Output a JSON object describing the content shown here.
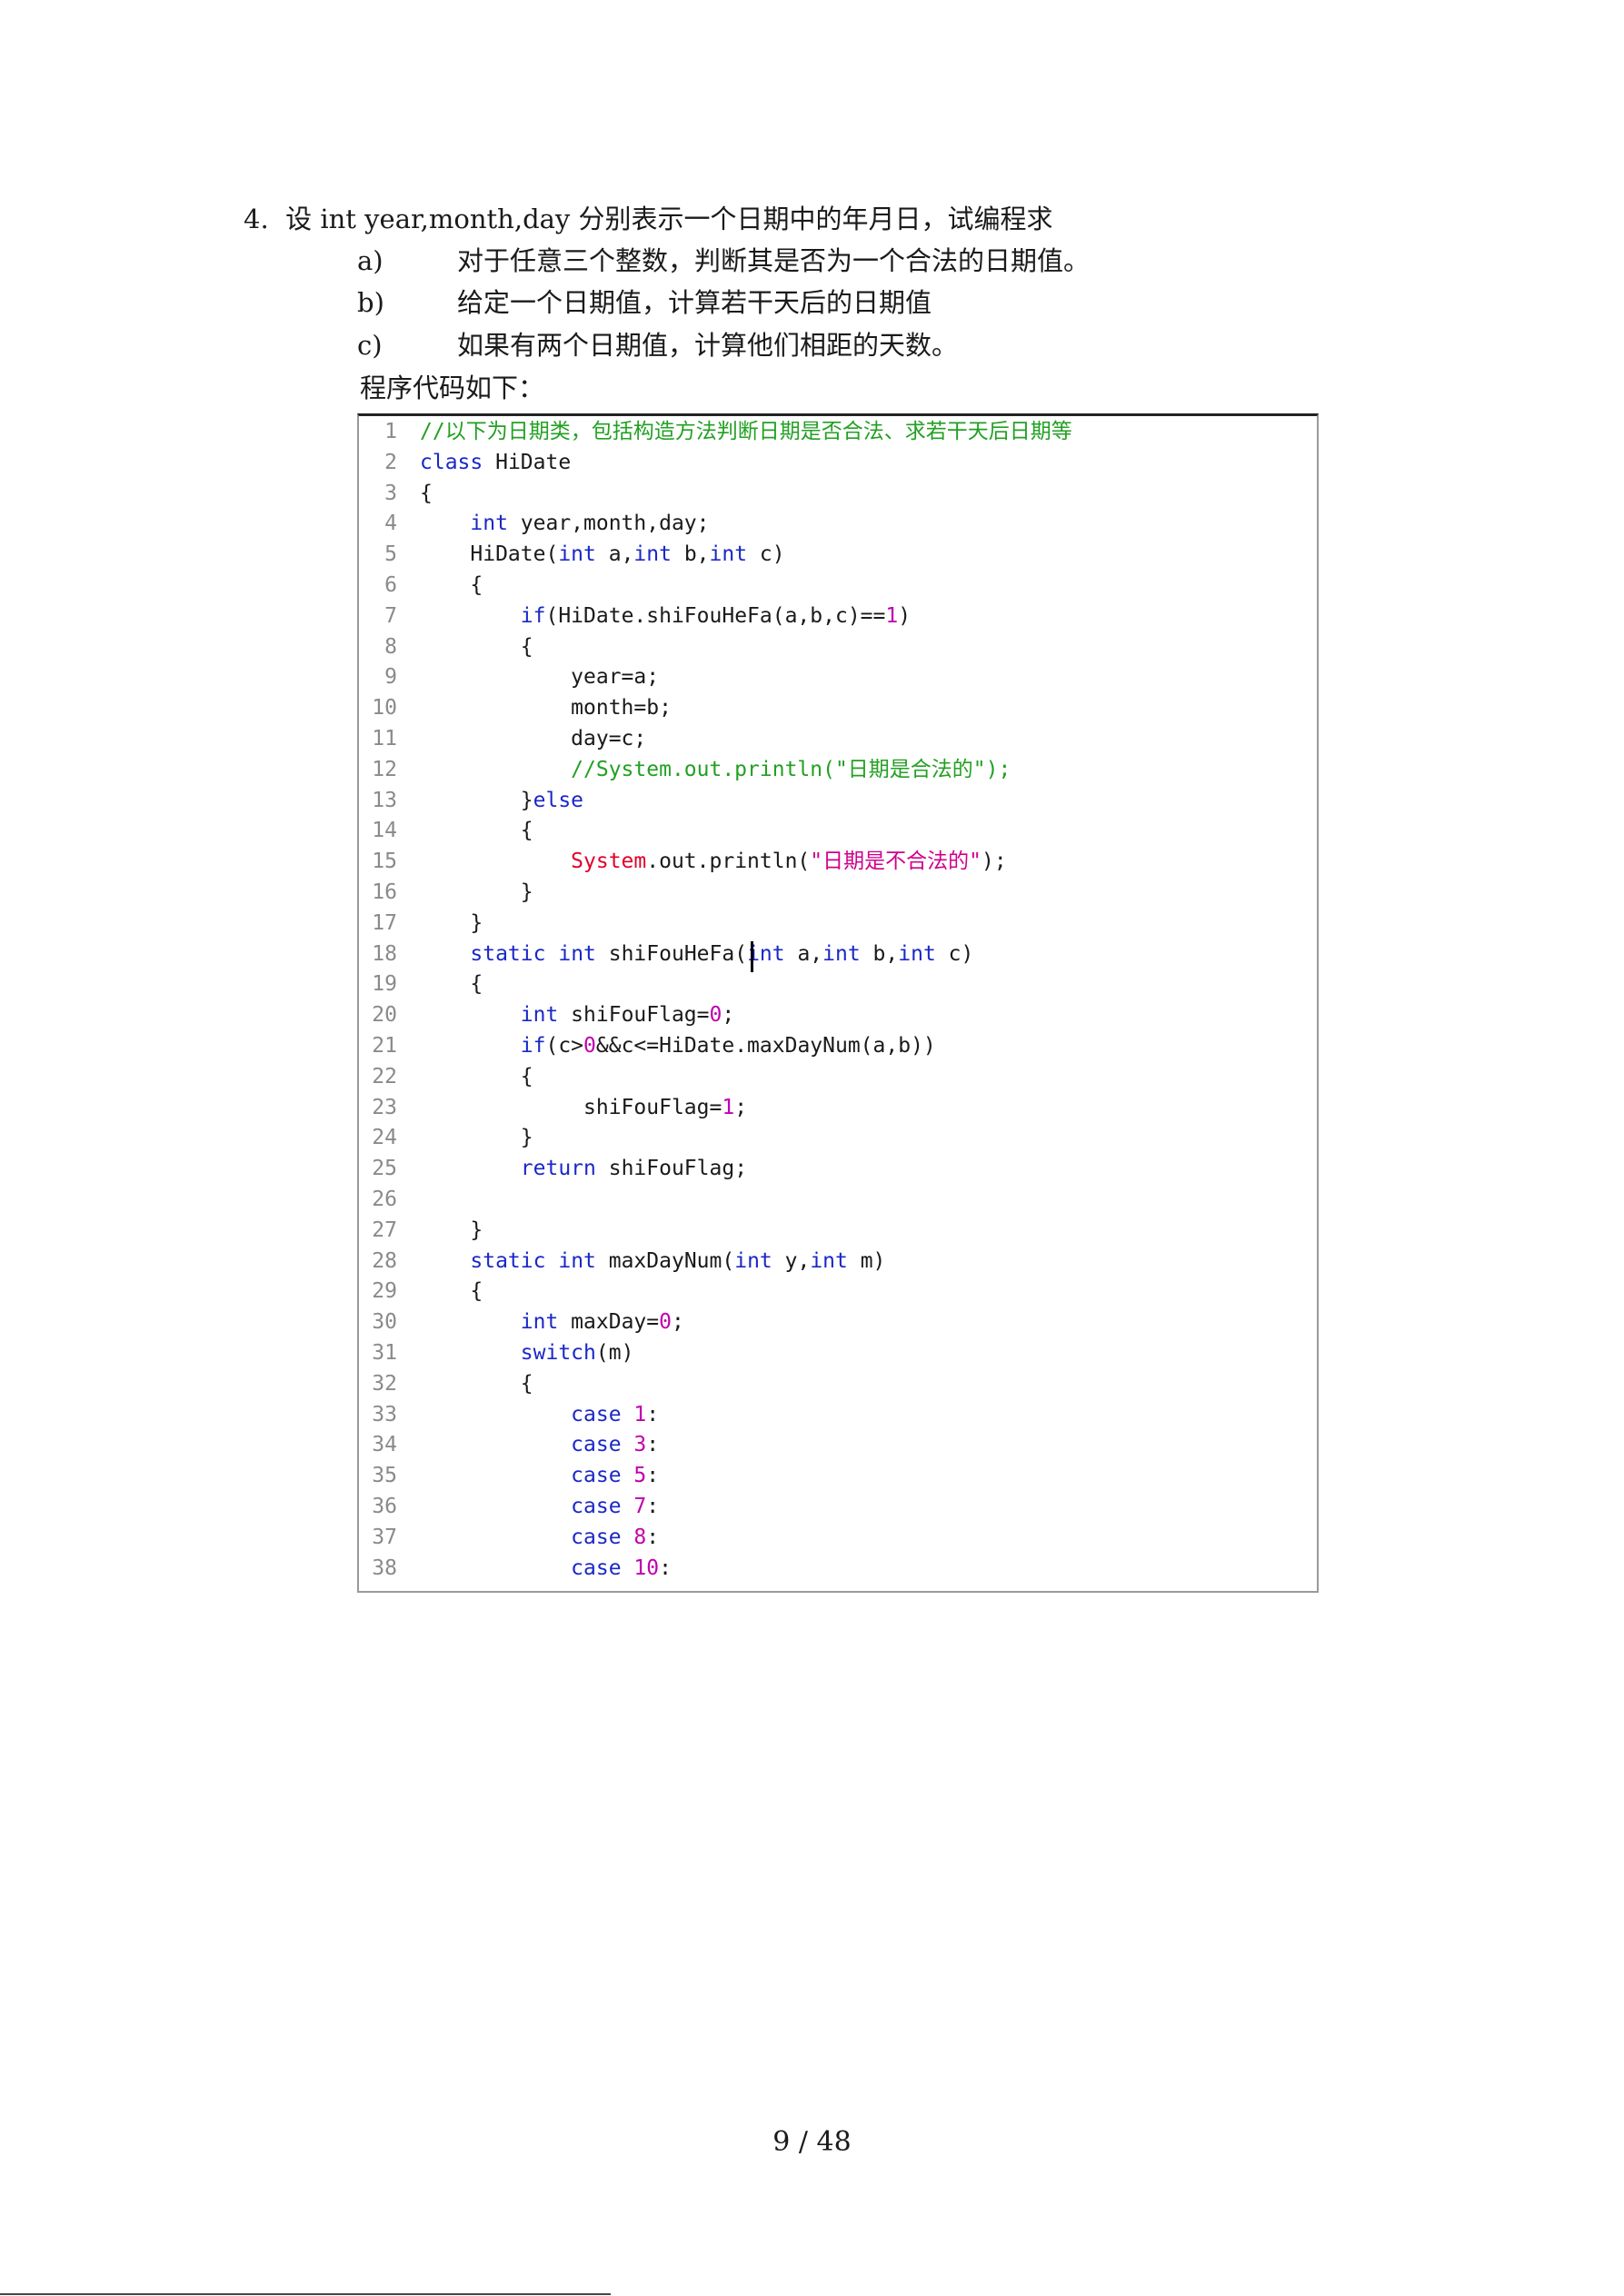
{
  "question": {
    "heading": "4.  设 int year,month,day 分别表示一个日期中的年月日，试编程求",
    "items": [
      {
        "label": "a)",
        "text": "对于任意三个整数，判断其是否为一个合法的日期值。"
      },
      {
        "label": "b)",
        "text": "给定一个日期值，计算若干天后的日期值"
      },
      {
        "label": "c)",
        "text": "如果有两个日期值，计算他们相距的天数。"
      }
    ],
    "intro": "程序代码如下："
  },
  "code": {
    "lines": [
      "//以下为日期类，包括构造方法判断日期是否合法、求若干天后日期等",
      "class HiDate",
      "{",
      "    int year,month,day;",
      "    HiDate(int a,int b,int c)",
      "    {",
      "        if(HiDate.shiFouHeFa(a,b,c)==1)",
      "        {",
      "            year=a;",
      "            month=b;",
      "            day=c;",
      "            //System.out.println(\"日期是合法的\");",
      "        }else",
      "        {",
      "            System.out.println(\"日期是不合法的\");",
      "        }",
      "    }",
      "    static int shiFouHeFa(int a,int b,int c)",
      "    {",
      "        int shiFouFlag=0;",
      "        if(c>0&&c<=HiDate.maxDayNum(a,b))",
      "        {",
      "             shiFouFlag=1;",
      "        }",
      "        return shiFouFlag;",
      "",
      "    }",
      "    static int maxDayNum(int y,int m)",
      "    {",
      "        int maxDay=0;",
      "        switch(m)",
      "        {",
      "            case 1:",
      "            case 3:",
      "            case 5:",
      "            case 7:",
      "            case 8:",
      "            case 10:"
    ]
  },
  "footer": {
    "page": "9 / 48"
  },
  "colors": {
    "keyword": "#1a28c8",
    "comment": "#22a022",
    "string": "#d0008a",
    "number": "#c000b0",
    "system": "#e0002a"
  }
}
